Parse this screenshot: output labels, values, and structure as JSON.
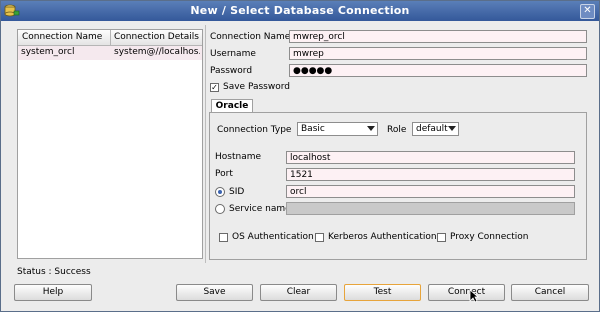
{
  "window": {
    "title": "New / Select Database Connection",
    "close_glyph": "✕",
    "app_icon": "database-plug-icon"
  },
  "connections": {
    "columns": [
      "Connection Name",
      "Connection Details"
    ],
    "rows": [
      {
        "name": "system_orcl",
        "details": "system@//localhos..."
      }
    ]
  },
  "form": {
    "connection_name_label": "Connection Name",
    "connection_name_value": "mwrep_orcl",
    "username_label": "Username",
    "username_value": "mwrep",
    "password_label": "Password",
    "password_value": "●●●●●",
    "save_password_label": "Save Password",
    "save_password_checked": true
  },
  "oracle_tab": {
    "tab_label": "Oracle",
    "connection_type_label": "Connection Type",
    "connection_type_value": "Basic",
    "role_label": "Role",
    "role_value": "default",
    "hostname_label": "Hostname",
    "hostname_value": "localhost",
    "port_label": "Port",
    "port_value": "1521",
    "sid_label": "SID",
    "sid_value": "orcl",
    "sid_selected": true,
    "service_name_label": "Service name",
    "service_name_value": "",
    "os_auth_label": "OS Authentication",
    "kerberos_auth_label": "Kerberos Authentication",
    "proxy_connection_label": "Proxy Connection"
  },
  "status": {
    "text": "Status : Success"
  },
  "buttons": {
    "help": "Help",
    "save": "Save",
    "clear": "Clear",
    "test": "Test",
    "connect": "Connect",
    "cancel": "Cancel"
  },
  "colors": {
    "titlebar": "#34589a",
    "field_background": "#fdf1f4",
    "selected_row": "#f5e9ee",
    "focus_border": "#e7a43b"
  }
}
